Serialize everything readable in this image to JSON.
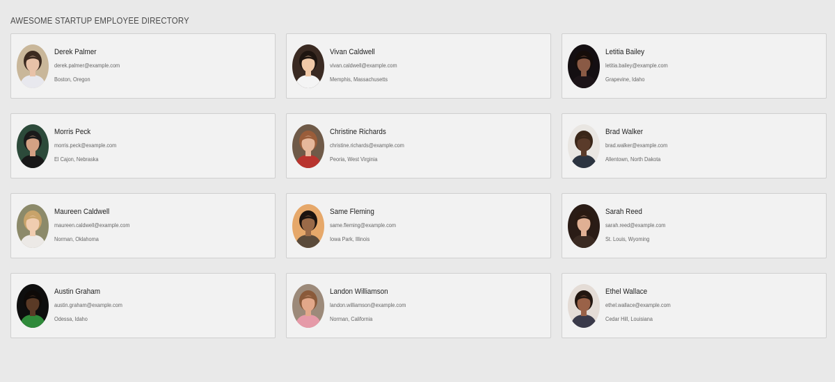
{
  "header": {
    "title": "AWESOME STARTUP EMPLOYEE DIRECTORY"
  },
  "employees": [
    {
      "name": "Derek Palmer",
      "email": "derek.palmer@example.com",
      "location": "Boston, Oregon",
      "avatar": {
        "bg": "#c9b79a",
        "skin": "#e8c2a8",
        "hair": "#3b2a20",
        "shirt": "#e8e8ee"
      }
    },
    {
      "name": "Vivan Caldwell",
      "email": "vivan.caldwell@example.com",
      "location": "Memphis, Massachusetts",
      "avatar": {
        "bg": "#3a2a22",
        "skin": "#f0c9a8",
        "hair": "#1e1510",
        "shirt": "#f4f4f4"
      }
    },
    {
      "name": "Letitia Bailey",
      "email": "letitia.bailey@example.com",
      "location": "Grapevine, Idaho",
      "avatar": {
        "bg": "#140f12",
        "skin": "#8a5a45",
        "hair": "#150d0a",
        "shirt": "#1c1418"
      }
    },
    {
      "name": "Morris Peck",
      "email": "morris.peck@example.com",
      "location": "El Cajon, Nebraska",
      "avatar": {
        "bg": "#2c4a3a",
        "skin": "#d3a184",
        "hair": "#1a1a1a",
        "shirt": "#181818"
      }
    },
    {
      "name": "Christine Richards",
      "email": "christine.richards@example.com",
      "location": "Peoria, West Virginia",
      "avatar": {
        "bg": "#6f5a48",
        "skin": "#e6b89c",
        "hair": "#9a5d3a",
        "shirt": "#b8342e"
      }
    },
    {
      "name": "Brad Walker",
      "email": "brad.walker@example.com",
      "location": "Allentown, North Dakota",
      "avatar": {
        "bg": "#e9e6e2",
        "skin": "#5a3b2a",
        "hair": "#3a2618",
        "shirt": "#2c3440"
      }
    },
    {
      "name": "Maureen Caldwell",
      "email": "maureen.caldwell@example.com",
      "location": "Norman, Oklahoma",
      "avatar": {
        "bg": "#8c8a6a",
        "skin": "#f0cdb0",
        "hair": "#c8a36a",
        "shirt": "#ece9e6"
      }
    },
    {
      "name": "Same Fleming",
      "email": "same.fleming@example.com",
      "location": "Iowa Park, Illinois",
      "avatar": {
        "bg": "#e6a86a",
        "skin": "#9a6a48",
        "hair": "#1c1410",
        "shirt": "#5a4a3a"
      }
    },
    {
      "name": "Sarah Reed",
      "email": "sarah.reed@example.com",
      "location": "St. Louis, Wyoming",
      "avatar": {
        "bg": "#2a1c16",
        "skin": "#e0b094",
        "hair": "#2a1a12",
        "shirt": "#3a2a22"
      }
    },
    {
      "name": "Austin Graham",
      "email": "austin.graham@example.com",
      "location": "Odessa, Idaho",
      "avatar": {
        "bg": "#0e0e0e",
        "skin": "#5a3a26",
        "hair": "#0e0a08",
        "shirt": "#2f8a3a"
      }
    },
    {
      "name": "Landon Williamson",
      "email": "landon.williamson@example.com",
      "location": "Norman, California",
      "avatar": {
        "bg": "#9c8a7a",
        "skin": "#e2a88a",
        "hair": "#8a5a3a",
        "shirt": "#e59aa8"
      }
    },
    {
      "name": "Ethel Wallace",
      "email": "ethel.wallace@example.com",
      "location": "Cedar Hill, Louisiana",
      "avatar": {
        "bg": "#e4dcd6",
        "skin": "#9a6248",
        "hair": "#221610",
        "shirt": "#3a3a4a"
      }
    }
  ]
}
